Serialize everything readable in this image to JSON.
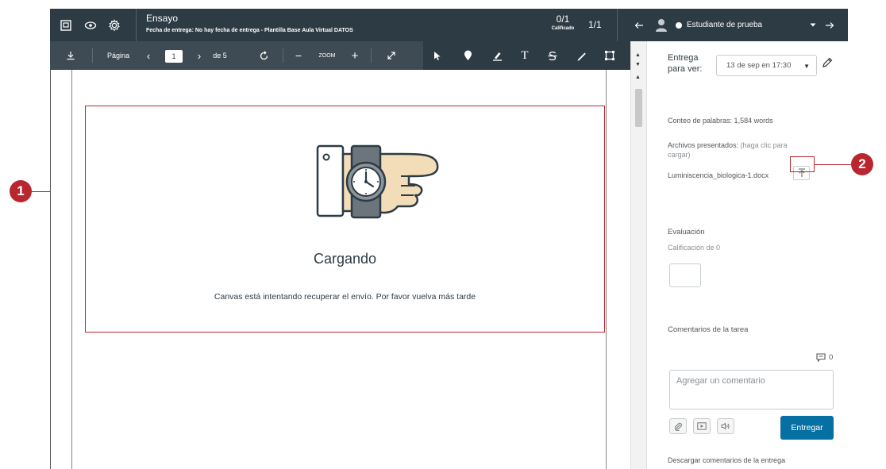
{
  "header": {
    "title": "Ensayo",
    "subtitle": "Fecha de entrega: No hay fecha de entrega - Plantilla Base Aula Virtual DATOS",
    "score_value": "0/1",
    "score_label": "Calificado",
    "count": "1/1",
    "student_name": "Estudiante de prueba",
    "icons": [
      "speedgrader-icon",
      "eye-icon",
      "gear-icon",
      "arrow-left-icon",
      "user-avatar-icon",
      "chevron-down-icon",
      "arrow-right-icon"
    ]
  },
  "toolbar": {
    "page_label": "Página",
    "page_value": "1",
    "page_total": "de 5",
    "zoom_label": "ZOOM",
    "icons": [
      "download-icon",
      "prev-page-icon",
      "next-page-icon",
      "rotate-icon",
      "zoom-out-icon",
      "zoom-in-icon",
      "fullscreen-icon",
      "pointer-icon",
      "point-annotation-icon",
      "highlight-icon",
      "text-icon",
      "strikeout-icon",
      "draw-icon",
      "area-icon"
    ]
  },
  "viewer": {
    "loading_title": "Cargando",
    "loading_message": "Canvas está intentando recuperar el envío. Por favor vuelva más tarde"
  },
  "panel": {
    "submission_label": "Entrega para ver:",
    "submission_value": "13 de sep en 17:30",
    "word_count": "Conteo de palabras: 1,584 words",
    "files_label": "Archivos presentados:",
    "files_hint": "(haga clic para cargar)",
    "file_name": "Luminiscencia_biologica-1.docx",
    "evaluation_label": "Evaluación",
    "grade_label": "Calificación de 0",
    "comments_label": "Comentarios de la tarea",
    "comment_count": "0",
    "comment_placeholder": "Agregar un comentario",
    "submit_label": "Entregar",
    "download_comments": "Descargar comentarios de la entrega"
  },
  "callouts": {
    "one": "1",
    "two": "2"
  },
  "colors": {
    "header_bg": "#2d3b45",
    "toolbar_bg": "#3f4b54",
    "callout": "#b8262e",
    "submit_button": "#0770a3"
  }
}
